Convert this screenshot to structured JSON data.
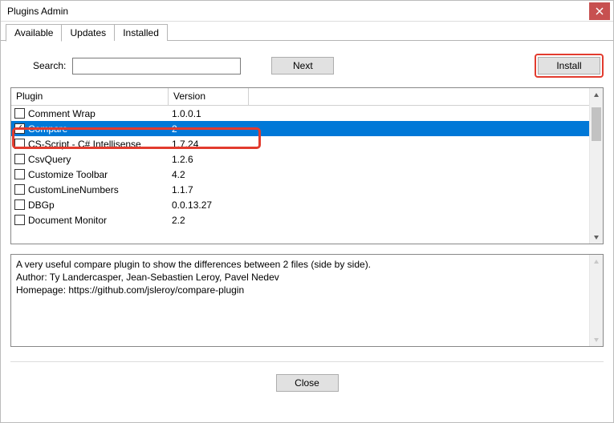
{
  "window": {
    "title": "Plugins Admin"
  },
  "tabs": [
    {
      "label": "Available"
    },
    {
      "label": "Updates"
    },
    {
      "label": "Installed"
    }
  ],
  "search": {
    "label": "Search:",
    "value": "",
    "placeholder": ""
  },
  "buttons": {
    "next": "Next",
    "install": "Install",
    "close": "Close"
  },
  "columns": {
    "plugin": "Plugin",
    "version": "Version"
  },
  "plugins": [
    {
      "name": "Comment Wrap",
      "version": "1.0.0.1",
      "checked": false,
      "selected": false
    },
    {
      "name": "Compare",
      "version": "2",
      "checked": true,
      "selected": true
    },
    {
      "name": "CS-Script - C# Intellisense",
      "version": "1.7.24",
      "checked": false,
      "selected": false
    },
    {
      "name": "CsvQuery",
      "version": "1.2.6",
      "checked": false,
      "selected": false
    },
    {
      "name": "Customize Toolbar",
      "version": "4.2",
      "checked": false,
      "selected": false
    },
    {
      "name": "CustomLineNumbers",
      "version": "1.1.7",
      "checked": false,
      "selected": false
    },
    {
      "name": "DBGp",
      "version": "0.0.13.27",
      "checked": false,
      "selected": false
    },
    {
      "name": "Document Monitor",
      "version": "2.2",
      "checked": false,
      "selected": false
    }
  ],
  "description": "A very useful compare plugin to show the differences between 2 files (side by side).\nAuthor: Ty Landercasper, Jean-Sebastien Leroy, Pavel Nedev\nHomepage: https://github.com/jsleroy/compare-plugin"
}
